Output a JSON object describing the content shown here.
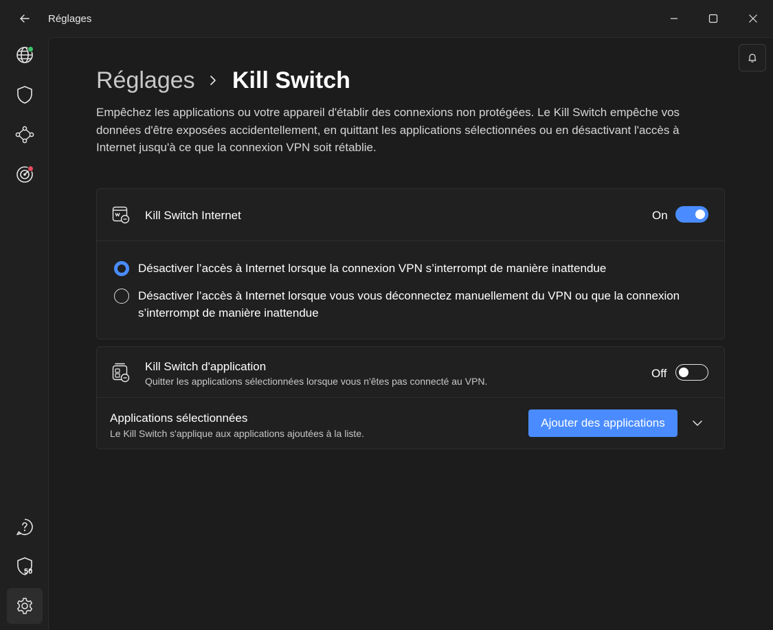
{
  "window": {
    "title": "Réglages"
  },
  "sidebar": {
    "items": [
      {
        "icon": "globe-icon",
        "status_color": "#3cc26a"
      },
      {
        "icon": "shield-icon"
      },
      {
        "icon": "meshnet-icon"
      },
      {
        "icon": "target-icon",
        "status_color": "#e84b5f"
      },
      {
        "icon": "help-icon"
      },
      {
        "icon": "shield-score-icon",
        "badge": "50"
      },
      {
        "icon": "gear-icon",
        "active": true
      }
    ]
  },
  "breadcrumb": {
    "parent": "Réglages",
    "current": "Kill Switch"
  },
  "description": "Empêchez les applications ou votre appareil d'établir des connexions non protégées. Le Kill Switch empêche vos données d'être exposées accidentellement, en quittant les applications sélectionnées ou en désactivant l'accès à Internet jusqu'à ce que la connexion VPN soit rétablie.",
  "internet_ks": {
    "title": "Kill Switch Internet",
    "toggle_label": "On",
    "enabled": true,
    "options": [
      {
        "label": "Désactiver l’accès à Internet lorsque la connexion VPN s’interrompt de manière inattendue",
        "checked": true
      },
      {
        "label": "Désactiver l’accès à Internet lorsque vous vous déconnectez manuellement du VPN ou que la connexion s’interrompt de manière inattendue",
        "checked": false
      }
    ]
  },
  "app_ks": {
    "title": "Kill Switch d'application",
    "subtitle": "Quitter les applications sélectionnées lorsque vous n'êtes pas connecté au VPN.",
    "toggle_label": "Off",
    "enabled": false,
    "selected_title": "Applications sélectionnées",
    "selected_sub": "Le Kill Switch s'applique aux applications ajoutées à la liste.",
    "add_button": "Ajouter des applications"
  },
  "colors": {
    "accent": "#4a8cff",
    "background": "#1c1c1c",
    "card": "#202020"
  }
}
